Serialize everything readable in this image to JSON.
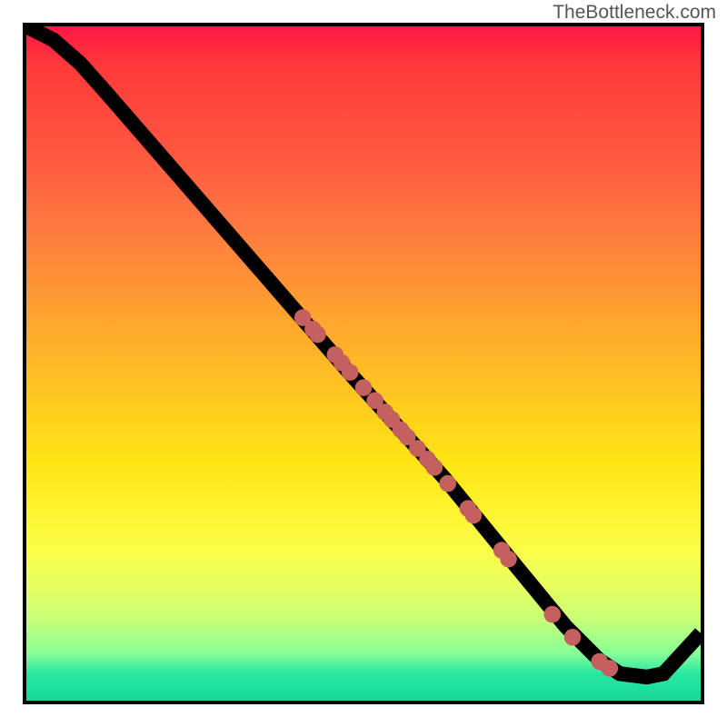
{
  "watermark": "TheBottleneck.com",
  "chart_data": {
    "type": "line",
    "title": "",
    "xlabel": "",
    "ylabel": "",
    "xlim": [
      0,
      100
    ],
    "ylim": [
      0,
      100
    ],
    "series": [
      {
        "name": "curve",
        "points": [
          {
            "x": 0,
            "y": 100
          },
          {
            "x": 4,
            "y": 98
          },
          {
            "x": 8,
            "y": 94.5
          },
          {
            "x": 12,
            "y": 90
          },
          {
            "x": 48,
            "y": 48.5
          },
          {
            "x": 62,
            "y": 33
          },
          {
            "x": 73,
            "y": 19.5
          },
          {
            "x": 80,
            "y": 11
          },
          {
            "x": 85,
            "y": 6
          },
          {
            "x": 88,
            "y": 4
          },
          {
            "x": 92,
            "y": 3.5
          },
          {
            "x": 94.5,
            "y": 4
          },
          {
            "x": 100,
            "y": 10
          }
        ]
      }
    ],
    "markers": [
      {
        "x": 41,
        "y": 56.8
      },
      {
        "x": 42.5,
        "y": 55.1
      },
      {
        "x": 43.2,
        "y": 54.3
      },
      {
        "x": 45.8,
        "y": 51.3
      },
      {
        "x": 46.8,
        "y": 50.1
      },
      {
        "x": 48,
        "y": 48.7
      },
      {
        "x": 50,
        "y": 46.4
      },
      {
        "x": 51.7,
        "y": 44.5
      },
      {
        "x": 53.2,
        "y": 42.8
      },
      {
        "x": 54.2,
        "y": 41.7
      },
      {
        "x": 55.5,
        "y": 40.2
      },
      {
        "x": 56.5,
        "y": 39.1
      },
      {
        "x": 58,
        "y": 37.4
      },
      {
        "x": 59.5,
        "y": 35.8
      },
      {
        "x": 60.5,
        "y": 34.6
      },
      {
        "x": 62.5,
        "y": 32.2
      },
      {
        "x": 65.5,
        "y": 28.5
      },
      {
        "x": 66.3,
        "y": 27.5
      },
      {
        "x": 70.5,
        "y": 22.3
      },
      {
        "x": 71.5,
        "y": 21
      },
      {
        "x": 78,
        "y": 12.8
      },
      {
        "x": 81,
        "y": 9.4
      },
      {
        "x": 85,
        "y": 5.8
      },
      {
        "x": 86.5,
        "y": 4.8
      }
    ],
    "marker_radius_pct": 1.25,
    "gradient_colors": {
      "top": "#ff1744",
      "mid": "#ffe020",
      "bottom": "#18d89a"
    }
  }
}
